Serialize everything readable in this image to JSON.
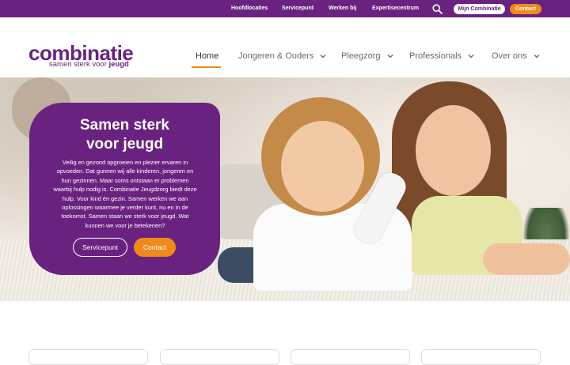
{
  "topbar": {
    "links": [
      "Hoofdlocaties",
      "Servicepunt",
      "Werken bij",
      "Expertisecentrum"
    ],
    "mijn_label": "Mijn Combinatie",
    "contact_label": "Contact"
  },
  "logo": {
    "word": "combinatie",
    "tagline_pre": "samen sterk voor ",
    "tagline_bold": "jeugd"
  },
  "nav": {
    "items": [
      "Home",
      "Jongeren & Ouders",
      "Pleegzorg",
      "Professionals",
      "Over ons"
    ],
    "active": "Home"
  },
  "hero": {
    "title_line1": "Samen sterk",
    "title_line2": "voor jeugd",
    "body": "Veilig en gezond opgroeien en plezier ervaren in opvoeden. Dat gunnen wij alle kinderen, jongeren en hun gezinnen. Maar soms ontstaan er problemen waarbij hulp nodig is. Combinatie Jeugdzorg biedt deze hulp. Voor kind én gezin. Samen werken we aan oplossingen waarmee je verder kunt, nu en in de toekomst. Samen staan we sterk voor jeugd. Wat kunnen we voor je betekenen?",
    "button_servicepunt": "Servicepunt",
    "button_contact": "Contact"
  },
  "colors": {
    "brand_purple": "#6a2280",
    "accent_orange": "#f08a1a"
  },
  "icons": {
    "search": "search-icon",
    "chevron": "chevron-down-icon"
  }
}
